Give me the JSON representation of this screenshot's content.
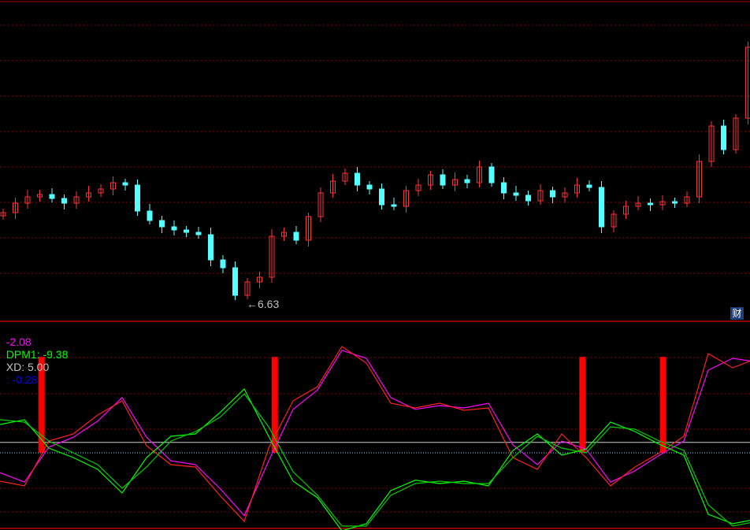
{
  "chart_data": [
    {
      "type": "candlestick",
      "title": "",
      "price_low_label": "6.63",
      "low_marker": "←",
      "closes": [
        7.76,
        7.88,
        7.96,
        7.99,
        7.94,
        7.88,
        7.96,
        8.01,
        8.06,
        8.14,
        8.11,
        7.78,
        7.66,
        7.58,
        7.54,
        7.51,
        7.48,
        7.16,
        7.06,
        6.71,
        6.88,
        6.94,
        7.46,
        7.51,
        7.41,
        7.71,
        8.01,
        8.16,
        8.26,
        8.11,
        8.06,
        7.86,
        7.84,
        8.04,
        8.11,
        8.24,
        8.11,
        8.18,
        8.14,
        8.34,
        8.14,
        8.01,
        7.98,
        7.91,
        8.04,
        7.96,
        8.01,
        8.11,
        8.08,
        7.58,
        7.74,
        7.84,
        7.88,
        7.86,
        7.9,
        7.88,
        7.96,
        8.41,
        8.86,
        8.56,
        8.96,
        9.86
      ],
      "grid": true,
      "colors": {
        "up": "#ff3232",
        "down": "#54ffff",
        "grid": "#8b0000"
      }
    },
    {
      "type": "line",
      "legend": [
        {
          "text": "-2.08",
          "color": "#ff00ff"
        },
        {
          "text": "DPM1: -9.38",
          "color": "#00ff00"
        },
        {
          "text": "XD: 5.00",
          "color": "#c0c0c0"
        },
        {
          "text": ": -0.28",
          "color": "#0000ff"
        }
      ],
      "series": [
        {
          "name": "magenta",
          "color": "#ff00ff",
          "values": [
            -4.2,
            -6.2,
            1.2,
            3.3,
            6.7,
            11.7,
            3.3,
            -1.7,
            -2.5,
            -7.5,
            -13.3,
            -1.7,
            9.2,
            13.3,
            21.7,
            20.0,
            11.7,
            9.2,
            10.0,
            9.5,
            10.5,
            1.7,
            -2.5,
            2.5,
            0.8,
            -6.2,
            -3.8,
            -0.5,
            2.5,
            17.5,
            20.0,
            19.2
          ]
        },
        {
          "name": "red",
          "color": "#ff2020",
          "values": [
            -6.0,
            -7.0,
            2.5,
            4.0,
            8.0,
            11.0,
            1.5,
            -2.5,
            -3.0,
            -9.0,
            -14.5,
            1.0,
            11.0,
            14.0,
            22.5,
            19.0,
            10.5,
            9.5,
            10.5,
            9.0,
            9.5,
            -1.0,
            -3.5,
            4.0,
            -1.0,
            -7.0,
            -3.0,
            0.0,
            3.5,
            21.0,
            18.0,
            20.0
          ]
        },
        {
          "name": "green1",
          "color": "#00ff00",
          "values": [
            6.0,
            7.0,
            1.0,
            -1.0,
            -3.5,
            -8.5,
            -1.0,
            3.5,
            4.0,
            8.5,
            13.5,
            3.5,
            -6.0,
            -9.5,
            -16.5,
            -15.0,
            -8.0,
            -5.8,
            -6.5,
            -6.0,
            -7.0,
            0.5,
            4.0,
            -0.5,
            0.8,
            6.5,
            4.5,
            1.8,
            -0.5,
            -13.0,
            -15.0,
            -14.0
          ]
        },
        {
          "name": "green2",
          "color": "#00cc00",
          "values": [
            7.0,
            6.5,
            2.5,
            0.0,
            -2.5,
            -7.5,
            -3.0,
            2.5,
            4.5,
            7.5,
            12.5,
            5.5,
            -4.0,
            -9.0,
            -15.5,
            -15.5,
            -9.0,
            -6.5,
            -6.0,
            -6.5,
            -6.5,
            -1.0,
            3.5,
            1.0,
            0.0,
            5.5,
            5.0,
            2.5,
            0.5,
            -11.0,
            -15.5,
            -14.5
          ]
        }
      ],
      "signal_line": 2.2,
      "bars_at_index": [
        3.4,
        22.5,
        47.7,
        54.3
      ],
      "bar_height": 20.3,
      "ylim": [
        -17,
        23
      ]
    }
  ]
}
